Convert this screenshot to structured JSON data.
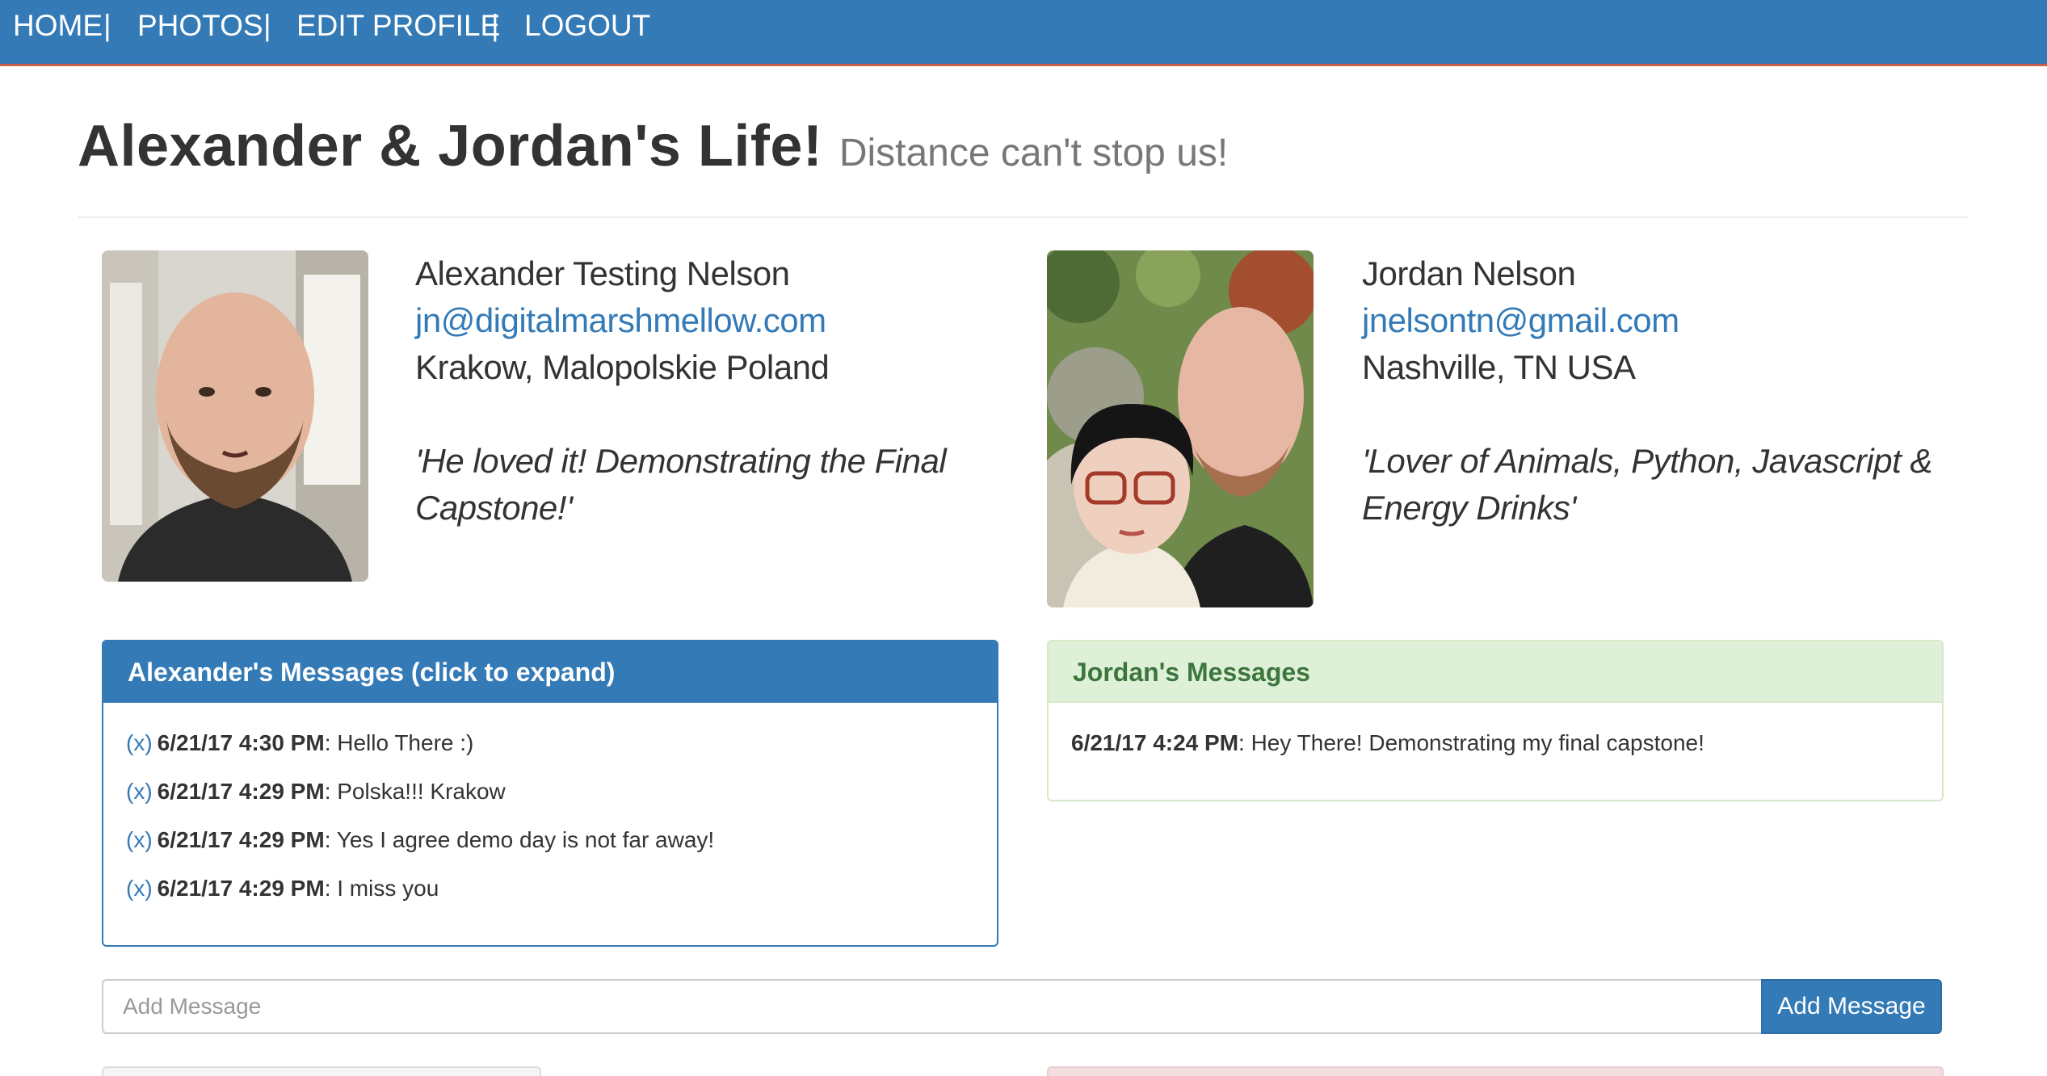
{
  "nav": {
    "home": "HOME",
    "photos": "PHOTOS",
    "edit_profile": "EDIT PROFILE",
    "logout": "LOGOUT",
    "separator": "|"
  },
  "header": {
    "title": "Alexander & Jordan's Life!",
    "subtitle": "Distance can't stop us!"
  },
  "profiles": {
    "left": {
      "name": "Alexander Testing Nelson",
      "email": "jn@digitalmarshmellow.com",
      "location": "Krakow, Malopolskie Poland",
      "quote_line1": "'He loved it! Demonstrating the Final",
      "quote_line2": "Capstone!'"
    },
    "right": {
      "name": "Jordan Nelson",
      "email": "jnelsontn@gmail.com",
      "location": "Nashville, TN USA",
      "quote_line1": "'Lover of Animals, Python, Javascript &",
      "quote_line2": "Energy Drinks'"
    }
  },
  "panels": {
    "left": {
      "title": "Alexander's Messages (click to expand)",
      "delete_label": "(x)",
      "messages": [
        {
          "time": "6/21/17 4:30 PM",
          "text": ": Hello There :)"
        },
        {
          "time": "6/21/17 4:29 PM",
          "text": ": Polska!!! Krakow"
        },
        {
          "time": "6/21/17 4:29 PM",
          "text": ": Yes I agree demo day is not far away!"
        },
        {
          "time": "6/21/17 4:29 PM",
          "text": ": I miss you"
        }
      ]
    },
    "right": {
      "title": "Jordan's Messages",
      "messages": [
        {
          "time": "6/21/17 4:24 PM",
          "text": ": Hey There! Demonstrating my final capstone!"
        }
      ]
    }
  },
  "composer": {
    "placeholder": "Add Message",
    "button_label": "Add Message"
  },
  "colors": {
    "primary": "#337ab7",
    "success_bg": "#dff0d8",
    "success_text": "#3c763d",
    "nav_accent": "#c8604a"
  }
}
